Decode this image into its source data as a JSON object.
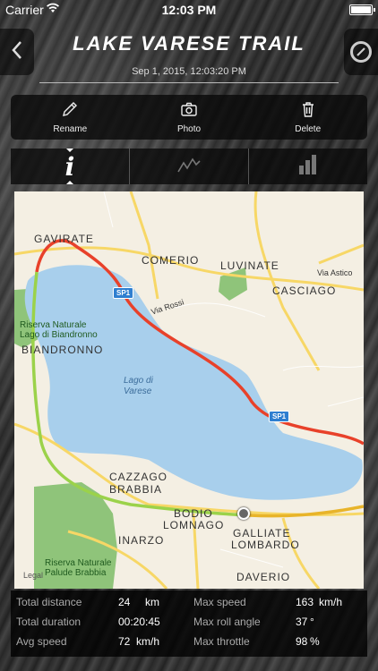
{
  "status_bar": {
    "carrier": "Carrier",
    "time": "12:03 PM"
  },
  "header": {
    "title": "LAKE VARESE TRAIL",
    "subtitle": "Sep 1, 2015, 12:03:20 PM",
    "back_icon": "chevron-left-icon",
    "right_icon": "settings-ring-icon"
  },
  "toolbar": {
    "items": [
      {
        "label": "Rename",
        "icon": "pencil-icon"
      },
      {
        "label": "Photo",
        "icon": "camera-icon"
      },
      {
        "label": "Delete",
        "icon": "trash-icon"
      }
    ]
  },
  "tabs": [
    {
      "icon": "info-icon",
      "glyph": "i",
      "active": true
    },
    {
      "icon": "line-chart-icon",
      "active": false
    },
    {
      "icon": "bar-chart-icon",
      "active": false
    }
  ],
  "map": {
    "towns": [
      "GAVIRATE",
      "COMERIO",
      "LUVINATE",
      "CASCIAGO",
      "BIANDRONNO",
      "CAZZAGO",
      "BRABBIA",
      "INARZO",
      "BODIO",
      "LOMNAGO",
      "GALLIATE",
      "LOMBARDO",
      "DAVERIO"
    ],
    "streets": [
      "Via Rossi",
      "Via Astico"
    ],
    "lake": [
      "Lago di",
      "Varese"
    ],
    "parks": [
      [
        "Riserva Naturale",
        "Lago di Biandronno"
      ],
      [
        "Riserva Naturale",
        "Palude Brabbia"
      ]
    ],
    "road_badges": [
      "SP1",
      "SP1"
    ],
    "legal": "Legal",
    "colors": {
      "land": "#f4efe3",
      "water": "#a8cfec",
      "park": "#8fc47a",
      "road": "#f7d766",
      "track_green": "#9bd24a",
      "track_red": "#e8412a"
    }
  },
  "stats": {
    "left": [
      {
        "label": "Total distance",
        "value": "24",
        "unit": "km"
      },
      {
        "label": "Total duration",
        "value": "00:20:45",
        "unit": ""
      },
      {
        "label": "Avg speed",
        "value": "72",
        "unit": "km/h"
      }
    ],
    "right": [
      {
        "label": "Max speed",
        "value": "163",
        "unit": "km/h"
      },
      {
        "label": "Max roll angle",
        "value": "37",
        "unit": "°"
      },
      {
        "label": "Max throttle",
        "value": "98",
        "unit": "%"
      }
    ]
  }
}
